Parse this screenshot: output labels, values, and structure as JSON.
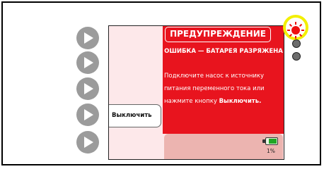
{
  "alert": {
    "title": "ПРЕДУПРЕЖДЕНИЕ",
    "subtitle": "ОШИБКА — БАТАРЕЯ РАЗРЯЖЕНА",
    "message_line": "Подключите насос к источнику питания переменного тока или нажмите кнопку",
    "message_emphasis": "Выключить."
  },
  "buttons": {
    "off_label": "Выключить"
  },
  "battery": {
    "percent_text": "1%",
    "level": 0.01
  },
  "indicators": {
    "alarm_color": "#ee1111",
    "highlight_color": "#f2ef00",
    "off_color": "#6d6d6d"
  },
  "icons": {
    "side_buttons": "play-triangle-icon",
    "alarm": "red-alarm-light-icon"
  }
}
